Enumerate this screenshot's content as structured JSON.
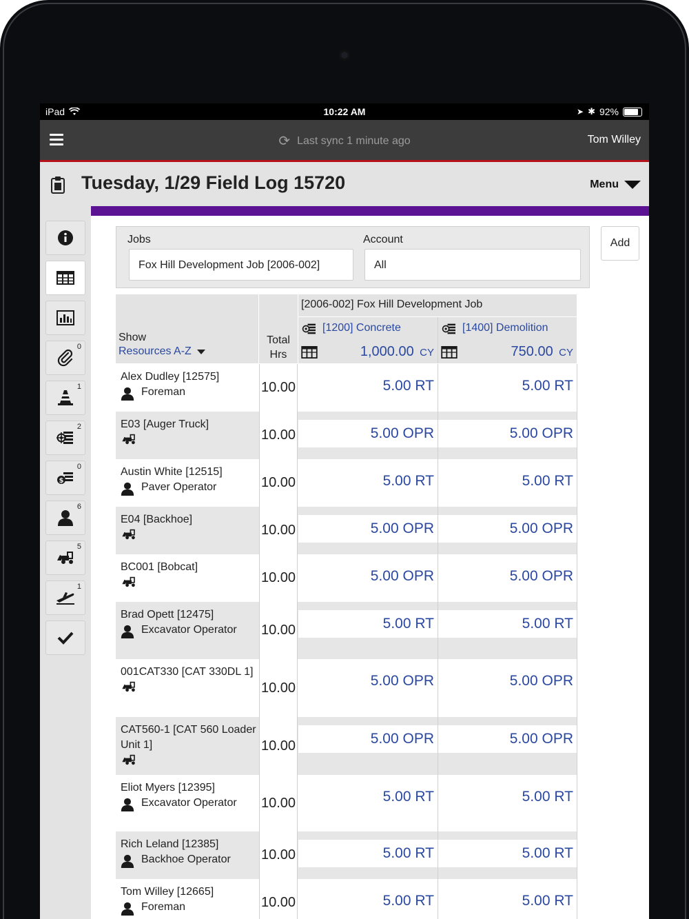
{
  "status_bar": {
    "device": "iPad",
    "time": "10:22 AM",
    "battery": "92%",
    "battery_level": 0.92
  },
  "app_bar": {
    "sync_text": "Last sync 1 minute ago",
    "user": "Tom Willey"
  },
  "title_bar": {
    "title": "Tuesday, 1/29 Field Log 15720",
    "menu_label": "Menu"
  },
  "sidebar": {
    "items": [
      {
        "name": "info-icon",
        "badge": ""
      },
      {
        "name": "timesheet-grid-icon",
        "badge": ""
      },
      {
        "name": "bar-chart-icon",
        "badge": ""
      },
      {
        "name": "paperclip-icon",
        "badge": "0"
      },
      {
        "name": "traffic-cone-icon",
        "badge": "1"
      },
      {
        "name": "cost-code-icon",
        "badge": "2"
      },
      {
        "name": "expense-icon",
        "badge": "0"
      },
      {
        "name": "person-icon",
        "badge": "6"
      },
      {
        "name": "equipment-icon",
        "badge": "5"
      },
      {
        "name": "plane-icon",
        "badge": "1"
      },
      {
        "name": "checkmark-icon",
        "badge": ""
      }
    ]
  },
  "filters": {
    "jobs_label": "Jobs",
    "jobs_value": "Fox Hill Development Job [2006-002]",
    "account_label": "Account",
    "account_value": "All",
    "add_label": "Add"
  },
  "grid": {
    "show_label": "Show",
    "sort_label": "Resources A-Z",
    "total_hrs_line1": "Total",
    "total_hrs_line2": "Hrs",
    "job_header": "[2006-002] Fox Hill Development Job",
    "columns": [
      {
        "code": "[1200] Concrete",
        "quantity": "1,000.00",
        "unit": "CY"
      },
      {
        "code": "[1400] Demolition",
        "quantity": "750.00",
        "unit": "CY"
      }
    ],
    "rows": [
      {
        "type": "person",
        "name": "Alex Dudley [12575]",
        "role": "Foreman",
        "total": "10.00",
        "values": [
          "5.00 RT",
          "5.00 RT"
        ]
      },
      {
        "type": "equipment",
        "name": "E03 [Auger Truck]",
        "role": "",
        "total": "10.00",
        "values": [
          "5.00 OPR",
          "5.00 OPR"
        ]
      },
      {
        "type": "person",
        "name": "Austin White [12515]",
        "role": "Paver Operator",
        "total": "10.00",
        "values": [
          "5.00 RT",
          "5.00 RT"
        ]
      },
      {
        "type": "equipment",
        "name": "E04 [Backhoe]",
        "role": "",
        "total": "10.00",
        "values": [
          "5.00 OPR",
          "5.00 OPR"
        ]
      },
      {
        "type": "equipment",
        "name": "BC001 [Bobcat]",
        "role": "",
        "total": "10.00",
        "values": [
          "5.00 OPR",
          "5.00 OPR"
        ]
      },
      {
        "type": "person",
        "name": "Brad Opett [12475]",
        "role": "Excavator Operator",
        "total": "10.00",
        "values": [
          "5.00 RT",
          "5.00 RT"
        ]
      },
      {
        "type": "equipment",
        "name": "001CAT330 [CAT 330DL 1]",
        "role": "",
        "total": "10.00",
        "values": [
          "5.00 OPR",
          "5.00 OPR"
        ]
      },
      {
        "type": "equipment",
        "name": "CAT560-1 [CAT 560 Loader Unit 1]",
        "role": "",
        "total": "10.00",
        "values": [
          "5.00 OPR",
          "5.00 OPR"
        ]
      },
      {
        "type": "person",
        "name": "Eliot Myers [12395]",
        "role": "Excavator Operator",
        "total": "10.00",
        "values": [
          "5.00 RT",
          "5.00 RT"
        ]
      },
      {
        "type": "person",
        "name": "Rich Leland [12385]",
        "role": "Backhoe Operator",
        "total": "10.00",
        "values": [
          "5.00 RT",
          "5.00 RT"
        ]
      },
      {
        "type": "person",
        "name": "Tom Willey [12665]",
        "role": "Foreman",
        "total": "10.00",
        "values": [
          "5.00 RT",
          "5.00 RT"
        ]
      }
    ]
  }
}
